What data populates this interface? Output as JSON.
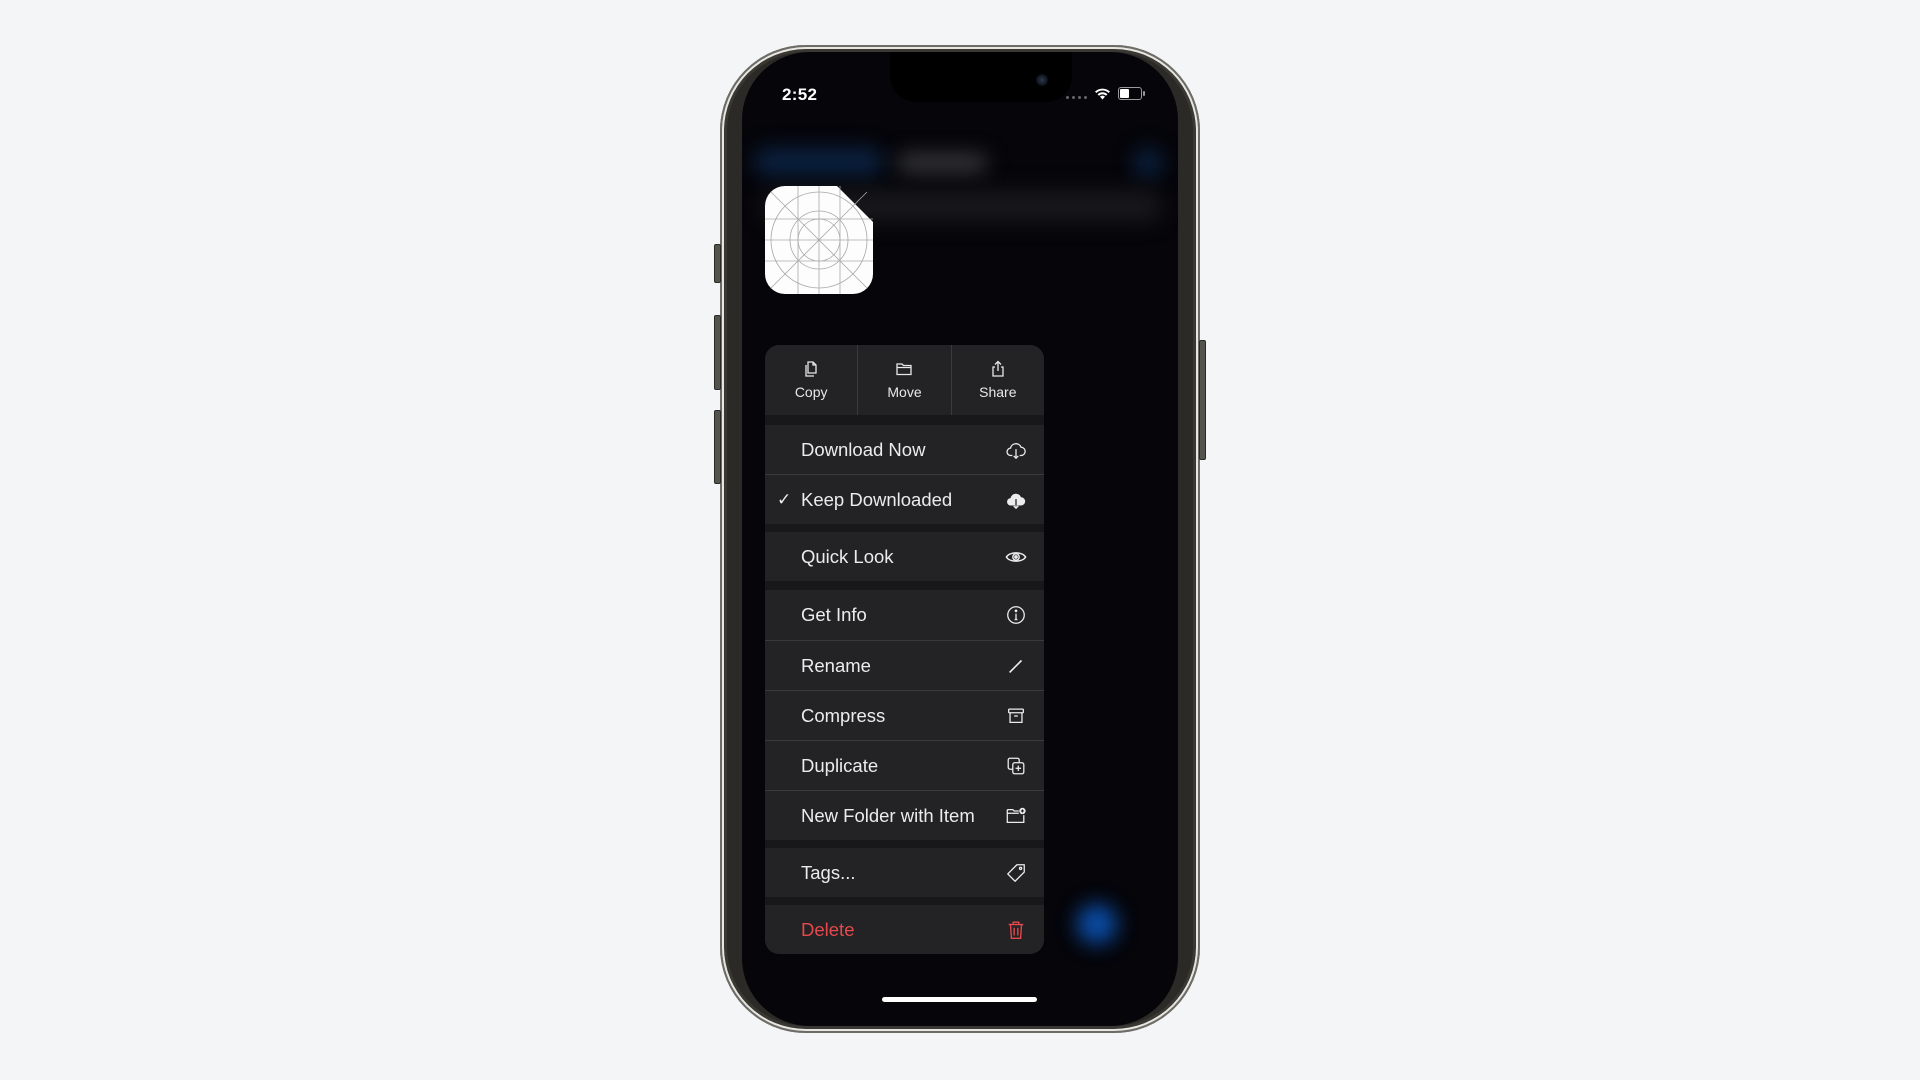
{
  "status_bar": {
    "time": "2:52",
    "battery_level": 0.45
  },
  "file_icon": "file-placeholder-icon",
  "context_menu": {
    "actions": [
      {
        "label": "Copy",
        "icon": "copy-icon"
      },
      {
        "label": "Move",
        "icon": "folder-icon"
      },
      {
        "label": "Share",
        "icon": "share-icon"
      }
    ],
    "groups": [
      [
        {
          "label": "Download Now",
          "icon": "cloud-download-icon",
          "checked": false
        },
        {
          "label": "Keep Downloaded",
          "icon": "cloud-download-filled-icon",
          "checked": true,
          "check_mark": "✓"
        }
      ],
      [
        {
          "label": "Quick Look",
          "icon": "eye-icon"
        }
      ],
      [
        {
          "label": "Get Info",
          "icon": "info-icon"
        },
        {
          "label": "Rename",
          "icon": "pencil-icon"
        },
        {
          "label": "Compress",
          "icon": "archive-box-icon"
        },
        {
          "label": "Duplicate",
          "icon": "duplicate-icon"
        },
        {
          "label": "New Folder with Item",
          "icon": "folder-badge-plus-icon"
        }
      ],
      [
        {
          "label": "Tags...",
          "icon": "tag-icon"
        }
      ],
      [
        {
          "label": "Delete",
          "icon": "trash-icon",
          "destructive": true
        }
      ]
    ]
  },
  "colors": {
    "destructive": "#e5484d",
    "menu_background": "#232325",
    "accent_blur": "#0a4a9a"
  }
}
